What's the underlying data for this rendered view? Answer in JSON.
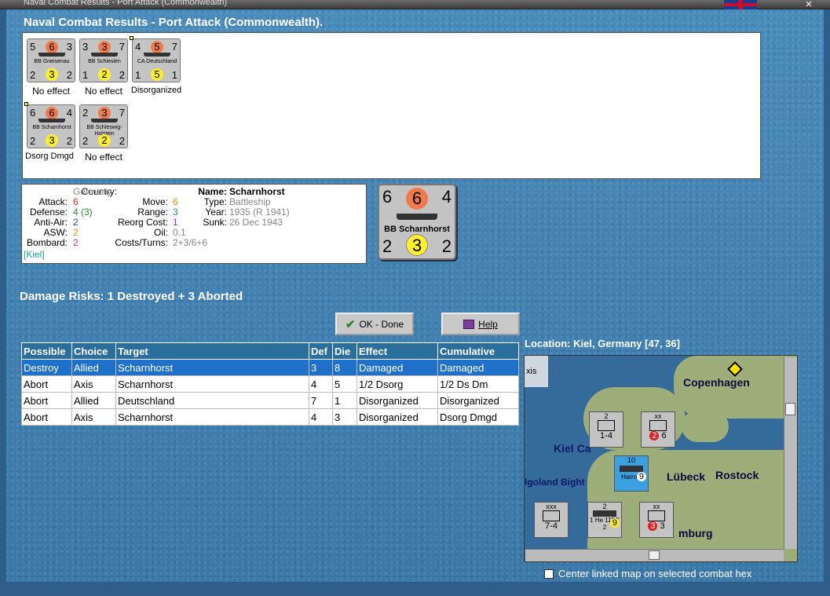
{
  "window": {
    "title": "Naval Combat Results - Port Attack (Commonwealth)"
  },
  "dialog": {
    "heading": "Naval Combat Results - Port Attack (Commonwealth)."
  },
  "units": [
    {
      "tl": "5",
      "tm": "6",
      "tr": "3",
      "name": "BB Gneisenau",
      "bl": "2",
      "bm": "3",
      "br": "2",
      "result": "No effect"
    },
    {
      "tl": "3",
      "tm": "3",
      "tr": "7",
      "name": "BB Schlesien",
      "bl": "1",
      "bm": "2",
      "br": "2",
      "result": "No effect"
    },
    {
      "tl": "4",
      "tm": "5",
      "tr": "7",
      "name": "CA Deutschland",
      "bl": "1",
      "bm": "5",
      "br": "1",
      "result": "Disorganized"
    },
    {
      "tl": "6",
      "tm": "6",
      "tr": "4",
      "name": "BB Scharnhorst",
      "bl": "2",
      "bm": "3",
      "br": "2",
      "result": "Dsorg Dmgd"
    },
    {
      "tl": "2",
      "tm": "3",
      "tr": "7",
      "name": "BB Schleswig-Holstein",
      "bl": "2",
      "bm": "2",
      "br": "2",
      "result": "No effect"
    }
  ],
  "info": {
    "country_label": "Country:",
    "country": "Germany",
    "attack_label": "Attack:",
    "attack": "6",
    "defense_label": "Defense:",
    "defense": "4 (3)",
    "antiair_label": "Anti-Air:",
    "antiair": "2",
    "asw_label": "ASW:",
    "asw": "2",
    "bombard_label": "Bombard:",
    "bombard": "2",
    "location_tag": "[Kiel]",
    "move_label": "Move:",
    "move": "6",
    "range_label": "Range:",
    "range": "3",
    "reorg_label": "Reorg Cost:",
    "reorg": "1",
    "oil_label": "Oil:",
    "oil": "0.1",
    "costs_label": "Costs/Turns:",
    "costs": "2+3/6+6",
    "name_label": "Name:",
    "name": "Scharnhorst",
    "type_label": "Type:",
    "type": "Battleship",
    "year_label": "Year:",
    "year": "1935 (R 1941)",
    "sunk_label": "Sunk:",
    "sunk": "26 Dec 1943"
  },
  "big_counter": {
    "tl": "6",
    "tm": "6",
    "tr": "4",
    "name": "BB Scharnhorst",
    "bl": "2",
    "bm": "3",
    "br": "2"
  },
  "damage_risks": "Damage Risks: 1 Destroyed + 3 Aborted",
  "buttons": {
    "ok": "OK - Done",
    "help": "Help"
  },
  "table": {
    "headers": [
      "Possible",
      "Choice",
      "Target",
      "Def",
      "Die",
      "Effect",
      "Cumulative"
    ],
    "rows": [
      [
        "Destroy",
        "Allied",
        "Scharnhorst",
        "3",
        "8",
        "Damaged",
        "Damaged"
      ],
      [
        "Abort",
        "Axis",
        "Scharnhorst",
        "4",
        "5",
        "1/2 Dsorg",
        "1/2 Ds Dm"
      ],
      [
        "Abort",
        "Allied",
        "Deutschland",
        "7",
        "1",
        "Disorganized",
        "Disorganized"
      ],
      [
        "Abort",
        "Axis",
        "Scharnhorst",
        "4",
        "3",
        "Disorganized",
        "Dsorg Dmgd"
      ]
    ]
  },
  "location": "Location:  Kiel, Germany [47, 36]",
  "map": {
    "labels": {
      "copenhagen": "Copenhagen",
      "kiel": "Kiel Ca",
      "lubeck": "Lübeck",
      "rostock": "Rostock",
      "heligoland": "lgoland Bight",
      "hamburg": "mburg",
      "axis_fragment": "xis"
    },
    "units": [
      {
        "top": "2",
        "val": "1-4",
        "extra": "xx"
      },
      {
        "top": "xx",
        "val": "6",
        "extra": "2"
      },
      {
        "top": "10",
        "val": "9",
        "extra": "Harrow"
      },
      {
        "top": "xxx",
        "val": "7-4",
        "extra": ""
      },
      {
        "top": "2",
        "val": "9",
        "extra": "1 He 115C 2"
      },
      {
        "top": "xx",
        "val": "3",
        "extra": "3"
      }
    ]
  },
  "center_checkbox": "Center linked map on selected combat hex",
  "colors": {
    "attack": "#e02020",
    "defense": "#2a8a2a",
    "antiair": "#2a4ab8",
    "asw": "#e08a00",
    "bombard": "#c020c0",
    "move": "#e08a00",
    "range": "#2a8a8a",
    "reorg": "#c020c0",
    "gray": "#888888",
    "tag": "#20a0a0"
  }
}
